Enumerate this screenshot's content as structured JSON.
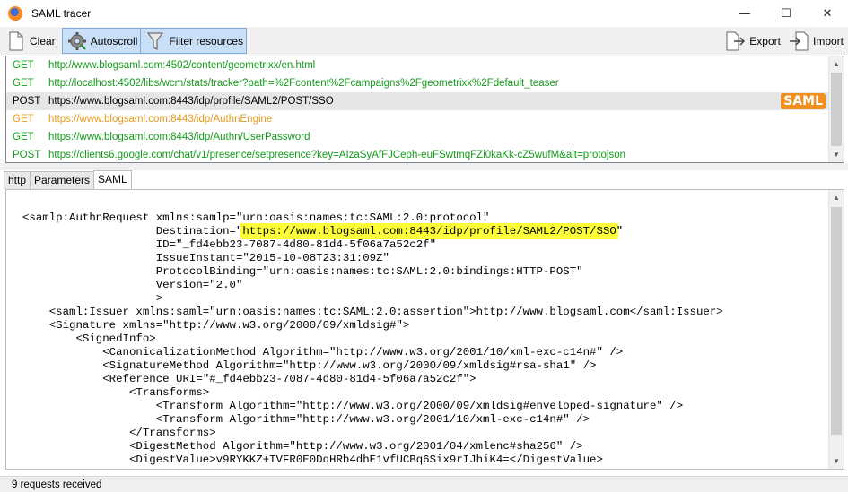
{
  "window": {
    "title": "SAML tracer",
    "minimize": "—",
    "maximize": "☐",
    "close": "✕"
  },
  "toolbar": {
    "clear_label": "Clear",
    "autoscroll_label": "Autoscroll",
    "filter_label": "Filter resources",
    "export_label": "Export",
    "import_label": "Import"
  },
  "requests": [
    {
      "method": "GET",
      "url": "http://www.blogsaml.com:4502/content/geometrixx/en.html",
      "color": "green",
      "selected": false,
      "saml": false
    },
    {
      "method": "GET",
      "url": "http://localhost:4502/libs/wcm/stats/tracker?path=%2Fcontent%2Fcampaigns%2Fgeometrixx%2Fdefault_teaser",
      "color": "green",
      "selected": false,
      "saml": false
    },
    {
      "method": "POST",
      "url": "https://www.blogsaml.com:8443/idp/profile/SAML2/POST/SSO",
      "color": "black",
      "selected": true,
      "saml": true
    },
    {
      "method": "GET",
      "url": "https://www.blogsaml.com:8443/idp/AuthnEngine",
      "color": "orange",
      "selected": false,
      "saml": false
    },
    {
      "method": "GET",
      "url": "https://www.blogsaml.com:8443/idp/Authn/UserPassword",
      "color": "green",
      "selected": false,
      "saml": false
    },
    {
      "method": "POST",
      "url": "https://clients6.google.com/chat/v1/presence/setpresence?key=AIzaSyAfFJCeph-euFSwtmqFZi0kaKk-cZ5wufM&alt=protojson",
      "color": "green",
      "selected": false,
      "saml": false
    }
  ],
  "saml_badge": "SAML",
  "tabs": [
    {
      "label": "http",
      "active": false
    },
    {
      "label": "Parameters",
      "active": false
    },
    {
      "label": "SAML",
      "active": true
    }
  ],
  "saml_lines": [
    {
      "pre": "<samlp:AuthnRequest xmlns:samlp=\"urn:oasis:names:tc:SAML:2.0:protocol\"",
      "hl": "",
      "post": ""
    },
    {
      "pre": "                    Destination=\"",
      "hl": "https://www.blogsaml.com:8443/idp/profile/SAML2/POST/SSO",
      "post": "\""
    },
    {
      "pre": "                    ID=\"_fd4ebb23-7087-4d80-81d4-5f06a7a52c2f\"",
      "hl": "",
      "post": ""
    },
    {
      "pre": "                    IssueInstant=\"2015-10-08T23:31:09Z\"",
      "hl": "",
      "post": ""
    },
    {
      "pre": "                    ProtocolBinding=\"urn:oasis:names:tc:SAML:2.0:bindings:HTTP-POST\"",
      "hl": "",
      "post": ""
    },
    {
      "pre": "                    Version=\"2.0\"",
      "hl": "",
      "post": ""
    },
    {
      "pre": "                    >",
      "hl": "",
      "post": ""
    },
    {
      "pre": "    <saml:Issuer xmlns:saml=\"urn:oasis:names:tc:SAML:2.0:assertion\">http://www.blogsaml.com</saml:Issuer>",
      "hl": "",
      "post": ""
    },
    {
      "pre": "    <Signature xmlns=\"http://www.w3.org/2000/09/xmldsig#\">",
      "hl": "",
      "post": ""
    },
    {
      "pre": "        <SignedInfo>",
      "hl": "",
      "post": ""
    },
    {
      "pre": "            <CanonicalizationMethod Algorithm=\"http://www.w3.org/2001/10/xml-exc-c14n#\" />",
      "hl": "",
      "post": ""
    },
    {
      "pre": "            <SignatureMethod Algorithm=\"http://www.w3.org/2000/09/xmldsig#rsa-sha1\" />",
      "hl": "",
      "post": ""
    },
    {
      "pre": "            <Reference URI=\"#_fd4ebb23-7087-4d80-81d4-5f06a7a52c2f\">",
      "hl": "",
      "post": ""
    },
    {
      "pre": "                <Transforms>",
      "hl": "",
      "post": ""
    },
    {
      "pre": "                    <Transform Algorithm=\"http://www.w3.org/2000/09/xmldsig#enveloped-signature\" />",
      "hl": "",
      "post": ""
    },
    {
      "pre": "                    <Transform Algorithm=\"http://www.w3.org/2001/10/xml-exc-c14n#\" />",
      "hl": "",
      "post": ""
    },
    {
      "pre": "                </Transforms>",
      "hl": "",
      "post": ""
    },
    {
      "pre": "                <DigestMethod Algorithm=\"http://www.w3.org/2001/04/xmlenc#sha256\" />",
      "hl": "",
      "post": ""
    },
    {
      "pre": "                <DigestValue>v9RYKKZ+TVFR0E0DqHRb4dhE1vfUCBq6Six9rIJhiK4=</DigestValue>",
      "hl": "",
      "post": ""
    }
  ],
  "status": {
    "text": "9 requests received"
  },
  "colors": {
    "get_green": "#149b1b",
    "redirect_orange": "#e69b1c",
    "saml_badge": "#f28f1e",
    "highlight": "#ffff38",
    "pressed_blue": "#c9dff7"
  }
}
